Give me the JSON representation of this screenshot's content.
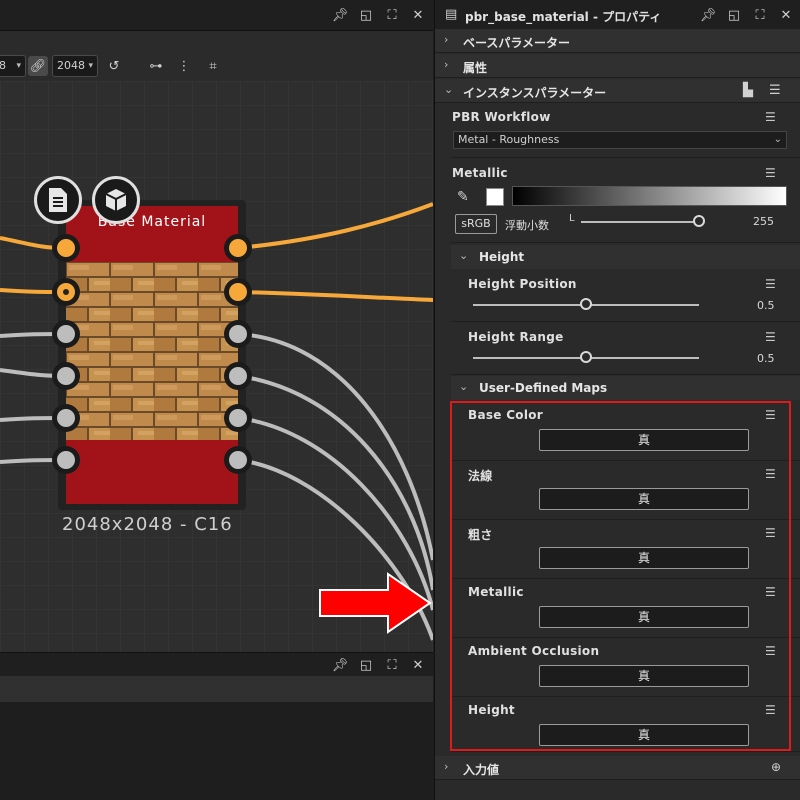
{
  "graph_toolbar": {
    "zoom_value": "8",
    "resolution_value": "2048"
  },
  "node": {
    "title": "Base Material",
    "resolution_label": "2048x2048 - C16"
  },
  "properties": {
    "title": "pbr_base_material - プロパティ",
    "sections": {
      "base_params": "ベースパラメーター",
      "attributes": "属性",
      "instance_params": "インスタンスパラメーター",
      "inputs": "入力値"
    },
    "pbr_workflow": {
      "label": "PBR Workflow",
      "value": "Metal - Roughness"
    },
    "metallic": {
      "label": "Metallic",
      "srgb_label": "sRGB",
      "float_label": "浮動小数",
      "channel_label": "L",
      "value": "255",
      "level": 1.0
    },
    "height_group": {
      "label": "Height",
      "position": {
        "label": "Height Position",
        "value": "0.5",
        "level": 0.5
      },
      "range": {
        "label": "Height Range",
        "value": "0.5",
        "level": 0.5
      }
    },
    "user_maps": {
      "label": "User-Defined Maps",
      "items": [
        {
          "label": "Base Color",
          "button": "真"
        },
        {
          "label": "法線",
          "button": "真"
        },
        {
          "label": "粗さ",
          "button": "真"
        },
        {
          "label": "Metallic",
          "button": "真"
        },
        {
          "label": "Ambient Occlusion",
          "button": "真"
        },
        {
          "label": "Height",
          "button": "真"
        }
      ]
    }
  },
  "colors": {
    "accent_orange": "#f6a93a",
    "node_red": "#a11318",
    "highlight_red": "#e01a1a",
    "arrow_red": "#ff0000"
  }
}
